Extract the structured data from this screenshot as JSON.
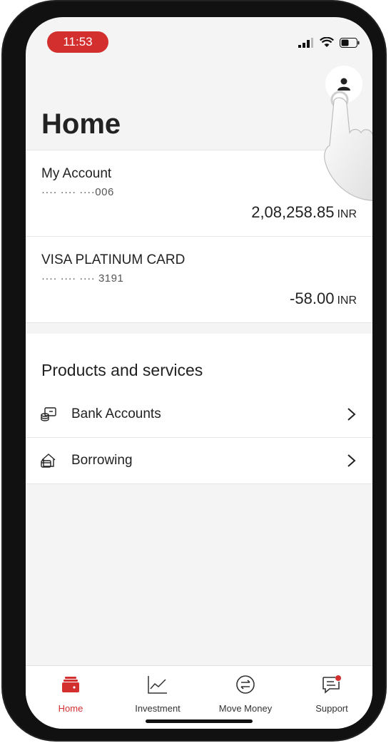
{
  "status_bar": {
    "time": "11:53"
  },
  "header": {
    "title": "Home"
  },
  "accounts": [
    {
      "name": "My Account",
      "number": "···· ···· ····006",
      "balance": "2,08,258.85",
      "currency": "INR"
    },
    {
      "name": "VISA PLATINUM CARD",
      "number": "···· ···· ···· 3191",
      "balance": "-58.00",
      "currency": "INR"
    }
  ],
  "products": {
    "title": "Products and services",
    "items": [
      {
        "label": "Bank Accounts",
        "icon": "coins-card-icon"
      },
      {
        "label": "Borrowing",
        "icon": "house-card-icon"
      }
    ]
  },
  "tabs": [
    {
      "label": "Home",
      "icon": "wallet-icon",
      "active": true
    },
    {
      "label": "Investment",
      "icon": "line-chart-icon",
      "active": false
    },
    {
      "label": "Move Money",
      "icon": "transfer-icon",
      "active": false
    },
    {
      "label": "Support",
      "icon": "chat-notification-icon",
      "active": false
    }
  ],
  "colors": {
    "accent": "#d32f2f",
    "background": "#f4f4f4",
    "text": "#222222"
  }
}
